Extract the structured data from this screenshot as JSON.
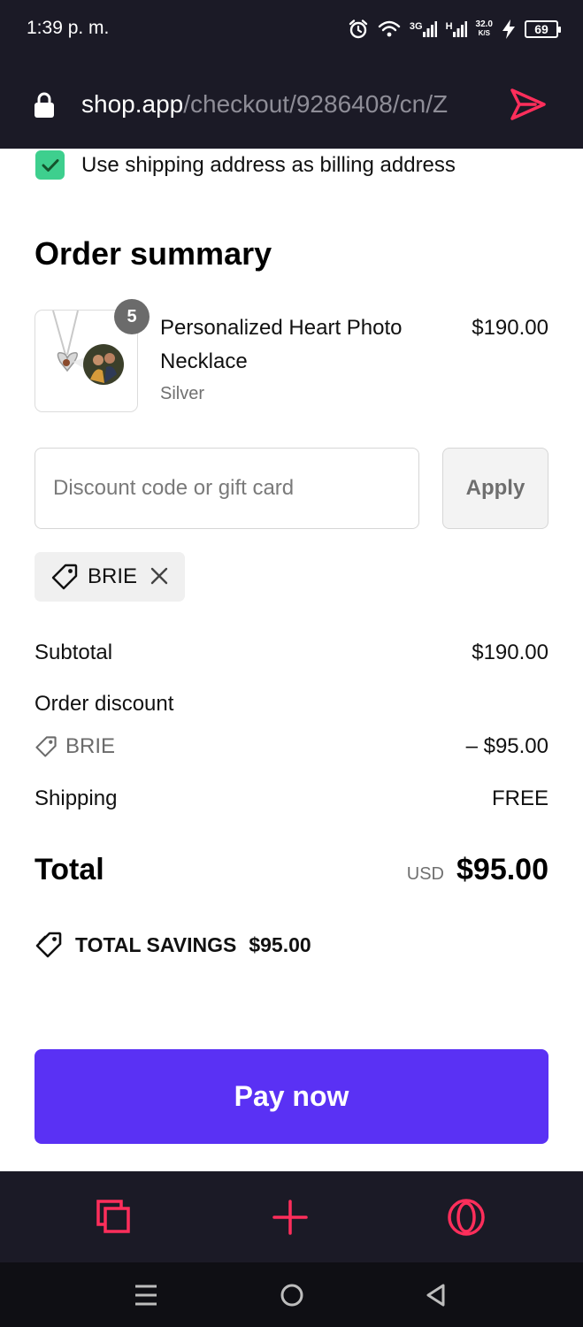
{
  "status_bar": {
    "time": "1:39 p. m.",
    "network_3g": "3G",
    "network_h": "H",
    "speed_value": "32.0",
    "speed_unit": "K/S",
    "battery": "69"
  },
  "browser": {
    "url_domain": "shop.app",
    "url_path": "/checkout/9286408/cn/Z"
  },
  "billing": {
    "checked": true,
    "label": "Use shipping address as billing address"
  },
  "order_summary": {
    "title": "Order summary",
    "item": {
      "quantity": "5",
      "name": "Personalized Heart Photo Necklace",
      "variant": "Silver",
      "price": "$190.00"
    }
  },
  "discount": {
    "placeholder": "Discount code or gift card",
    "value": "",
    "apply_label": "Apply",
    "applied_code": "BRIE"
  },
  "totals": {
    "subtotal_label": "Subtotal",
    "subtotal_value": "$190.00",
    "order_discount_label": "Order discount",
    "discount_code": "BRIE",
    "discount_value": "– $95.00",
    "shipping_label": "Shipping",
    "shipping_value": "FREE",
    "total_label": "Total",
    "currency": "USD",
    "total_value": "$95.00",
    "savings_label": "TOTAL SAVINGS",
    "savings_value": "$95.00"
  },
  "pay_button": {
    "label": "Pay now"
  },
  "colors": {
    "accent": "#5a31f4",
    "check": "#3ecf8e",
    "browser_accent": "#ff2e5b",
    "bar_background": "#1b1a26"
  },
  "icons": {
    "browser_bar": [
      "tabs-icon",
      "new-tab-plus-icon",
      "opera-menu-icon"
    ],
    "system_nav": [
      "recents-menu-icon",
      "home-icon",
      "back-icon"
    ]
  }
}
